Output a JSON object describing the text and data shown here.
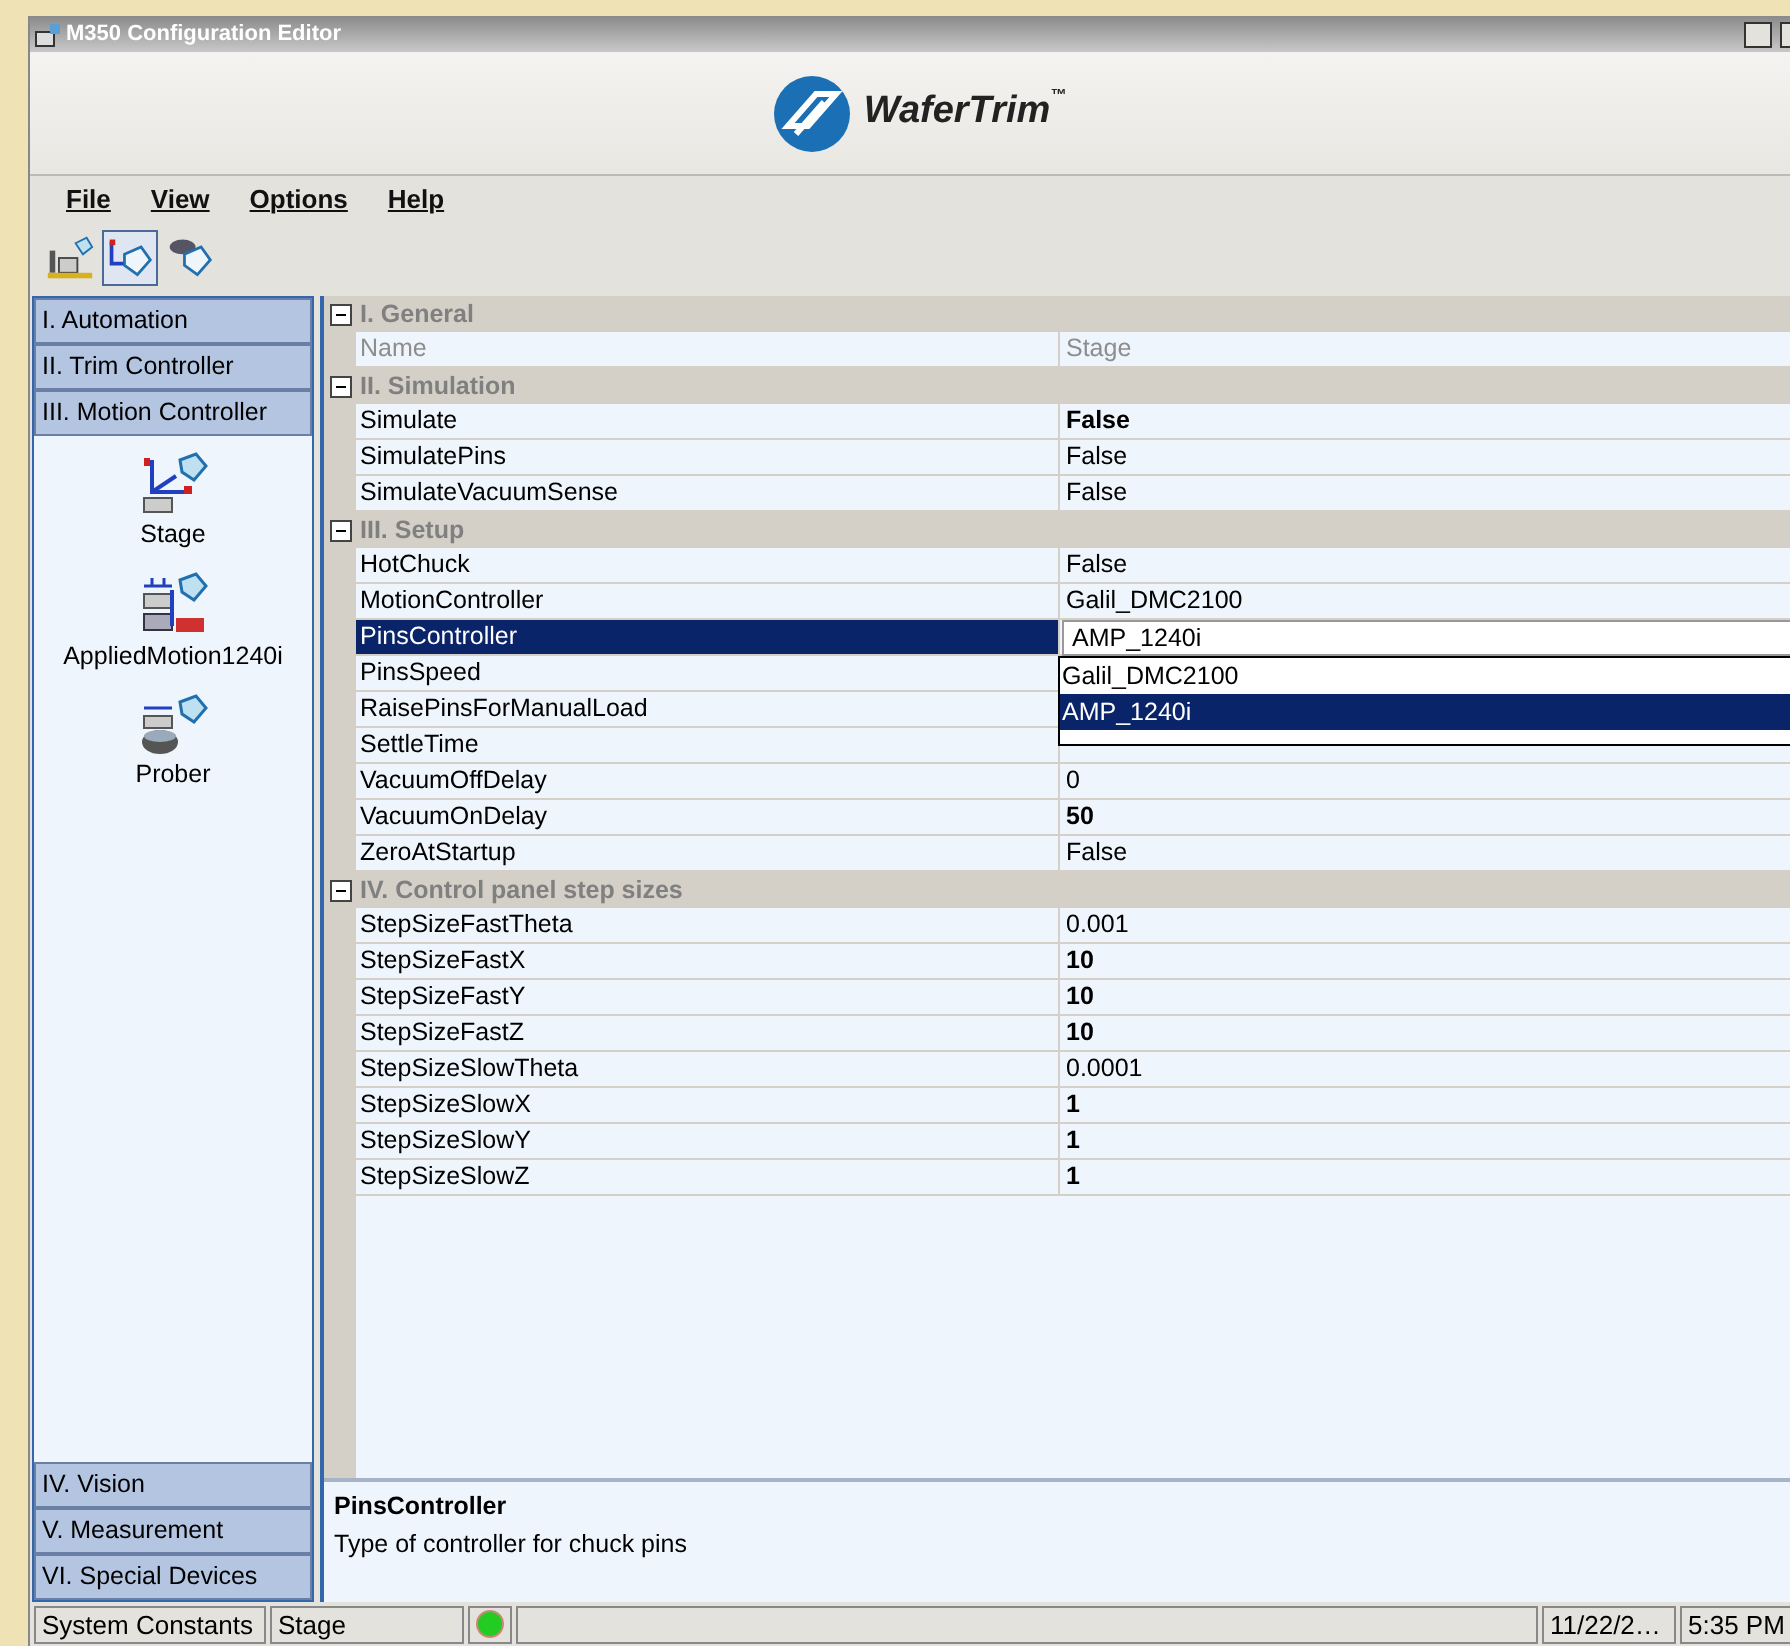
{
  "window": {
    "title": "M350 Configuration Editor",
    "logo_text": "WaferTrim",
    "trademark": "™"
  },
  "menu": [
    {
      "label": "File"
    },
    {
      "label": "View"
    },
    {
      "label": "Options"
    },
    {
      "label": "Help"
    }
  ],
  "toolbar": [
    {
      "selected": false
    },
    {
      "selected": true
    },
    {
      "selected": false
    }
  ],
  "sidebar": {
    "top_groups": [
      {
        "label": "I. Automation"
      },
      {
        "label": "II. Trim Controller"
      },
      {
        "label": "III. Motion Controller"
      }
    ],
    "items": [
      {
        "label": "Stage",
        "kind": "stage"
      },
      {
        "label": "AppliedMotion1240i",
        "kind": "motor"
      },
      {
        "label": "Prober",
        "kind": "prober"
      }
    ],
    "bottom_groups": [
      {
        "label": "IV. Vision"
      },
      {
        "label": "V. Measurement"
      },
      {
        "label": "VI. Special Devices"
      }
    ]
  },
  "grid": {
    "categories": [
      {
        "title": "I. General",
        "expanded": true,
        "rows": [
          {
            "name": "Name",
            "value": "Stage",
            "bold": false,
            "readonly": true,
            "selected": false
          }
        ]
      },
      {
        "title": "II. Simulation",
        "expanded": true,
        "rows": [
          {
            "name": "Simulate",
            "value": "False",
            "bold": true,
            "readonly": false,
            "selected": false
          },
          {
            "name": "SimulatePins",
            "value": "False",
            "bold": false,
            "readonly": false,
            "selected": false
          },
          {
            "name": "SimulateVacuumSense",
            "value": "False",
            "bold": false,
            "readonly": false,
            "selected": false
          }
        ]
      },
      {
        "title": "III. Setup",
        "expanded": true,
        "rows": [
          {
            "name": "HotChuck",
            "value": "False",
            "bold": false,
            "readonly": false,
            "selected": false
          },
          {
            "name": "MotionController",
            "value": "Galil_DMC2100",
            "bold": false,
            "readonly": false,
            "selected": false
          },
          {
            "name": "PinsController",
            "value": "AMP_1240i",
            "bold": false,
            "readonly": false,
            "selected": true
          },
          {
            "name": "PinsSpeed",
            "readonly": false,
            "selected": false
          },
          {
            "name": "RaisePinsForManualLoad",
            "readonly": false,
            "selected": false
          },
          {
            "name": "SettleTime",
            "readonly": false,
            "selected": false
          },
          {
            "name": "VacuumOffDelay",
            "value": "0",
            "bold": false,
            "readonly": false,
            "selected": false
          },
          {
            "name": "VacuumOnDelay",
            "value": "50",
            "bold": true,
            "readonly": false,
            "selected": false
          },
          {
            "name": "ZeroAtStartup",
            "value": "False",
            "bold": false,
            "readonly": false,
            "selected": false
          }
        ]
      },
      {
        "title": "IV. Control panel step sizes",
        "expanded": true,
        "rows": [
          {
            "name": "StepSizeFastTheta",
            "value": "0.001",
            "bold": false,
            "readonly": false,
            "selected": false
          },
          {
            "name": "StepSizeFastX",
            "value": "10",
            "bold": true,
            "readonly": false,
            "selected": false
          },
          {
            "name": "StepSizeFastY",
            "value": "10",
            "bold": true,
            "readonly": false,
            "selected": false
          },
          {
            "name": "StepSizeFastZ",
            "value": "10",
            "bold": true,
            "readonly": false,
            "selected": false
          },
          {
            "name": "StepSizeSlowTheta",
            "value": "0.0001",
            "bold": false,
            "readonly": false,
            "selected": false
          },
          {
            "name": "StepSizeSlowX",
            "value": "1",
            "bold": true,
            "readonly": false,
            "selected": false
          },
          {
            "name": "StepSizeSlowY",
            "value": "1",
            "bold": true,
            "readonly": false,
            "selected": false
          },
          {
            "name": "StepSizeSlowZ",
            "value": "1",
            "bold": true,
            "readonly": false,
            "selected": false
          }
        ]
      }
    ],
    "dropdown": {
      "options": [
        {
          "label": "Galil_DMC2100",
          "selected": false
        },
        {
          "label": "AMP_1240i",
          "selected": true
        }
      ]
    }
  },
  "description": {
    "title": "PinsController",
    "text": "Type of controller for chuck pins"
  },
  "status_bar": {
    "panels": [
      "System Constants",
      "Stage"
    ],
    "status_on": true,
    "date": "11/22/2…",
    "time": "5:35 PM"
  }
}
